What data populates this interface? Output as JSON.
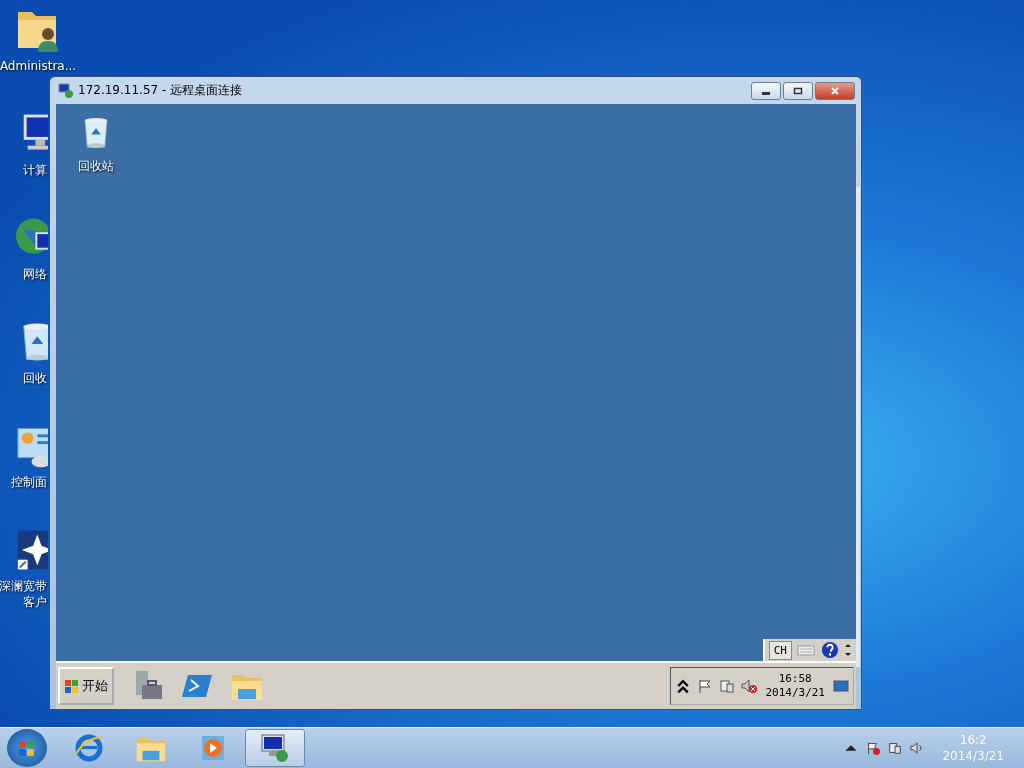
{
  "desktop_icons": [
    {
      "kind": "user-folder",
      "lines": [
        "Administra..."
      ]
    },
    {
      "kind": "computer",
      "lines": [
        "计算"
      ]
    },
    {
      "kind": "network",
      "lines": [
        "网络"
      ]
    },
    {
      "kind": "recycle-bin",
      "lines": [
        "回收"
      ]
    },
    {
      "kind": "control-panel",
      "lines": [
        "控制面"
      ]
    },
    {
      "kind": "app",
      "lines": [
        "深澜宽带",
        "客户"
      ]
    }
  ],
  "window": {
    "title": "172.19.11.57 - 远程桌面连接",
    "remote_desktop": {
      "icons": [
        {
          "kind": "recycle-bin",
          "lines": [
            "回收站"
          ]
        }
      ],
      "language_bar": {
        "language": "CH"
      },
      "taskbar": {
        "start_label": "开始",
        "pinned": [
          {
            "kind": "server-manager"
          },
          {
            "kind": "powershell"
          },
          {
            "kind": "folder"
          }
        ],
        "clock_time": "16:58",
        "clock_date": "2014/3/21"
      }
    }
  },
  "taskbar": {
    "pinned": [
      {
        "kind": "browser",
        "selected": false
      },
      {
        "kind": "folder",
        "selected": false
      },
      {
        "kind": "media",
        "selected": false
      },
      {
        "kind": "remote",
        "selected": true
      }
    ],
    "clock_time": "16:2",
    "clock_date": "2014/3/21"
  }
}
